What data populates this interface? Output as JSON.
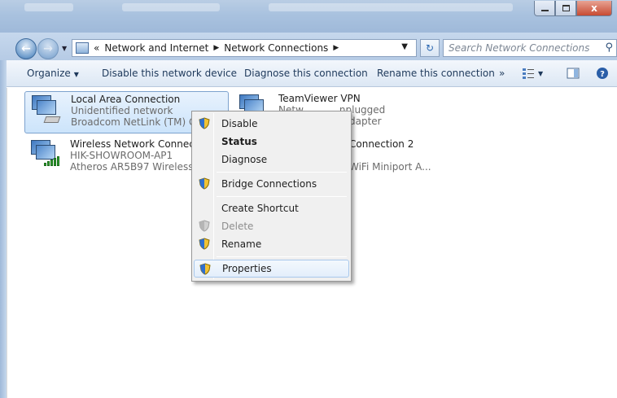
{
  "address": {
    "crumbs": [
      "Network and Internet",
      "Network Connections"
    ],
    "overflow": "«"
  },
  "search": {
    "placeholder": "Search Network Connections"
  },
  "commandbar": {
    "organize": "Organize",
    "disable": "Disable this network device",
    "diagnose": "Diagnose this connection",
    "rename": "Rename this connection",
    "more": "»"
  },
  "connections": [
    {
      "name": "Local Area Connection",
      "status": "Unidentified network",
      "device": "Broadcom NetLink (TM) Gig"
    },
    {
      "name": "TeamViewer VPN",
      "status": "Network cable unplugged",
      "device": "Adapter"
    },
    {
      "name": "Wireless Network Connectio",
      "status": "HIK-SHOWROOM-AP1",
      "device": "Atheros AR5B97 Wireless Ne"
    },
    {
      "name": "Connection 2",
      "status": "",
      "device": "WiFi Miniport A..."
    }
  ],
  "visible_fragments": {
    "teamviewer_status": "Netw",
    "teamviewer_status_tail": "nplugged",
    "teamviewer_device": "Adapter",
    "conn2_name": "Connection 2",
    "conn2_device": "WiFi Miniport A..."
  },
  "context_menu": {
    "items": [
      {
        "label": "Disable",
        "shield": true
      },
      {
        "label": "Status",
        "bold": true
      },
      {
        "label": "Diagnose"
      },
      {
        "label": "Bridge Connections",
        "shield": true
      },
      {
        "label": "Create Shortcut"
      },
      {
        "label": "Delete",
        "shield": true,
        "disabled": true
      },
      {
        "label": "Rename",
        "shield": true
      },
      {
        "label": "Properties",
        "shield": true,
        "hover": true
      }
    ]
  },
  "window": {
    "close_glyph": "x"
  }
}
